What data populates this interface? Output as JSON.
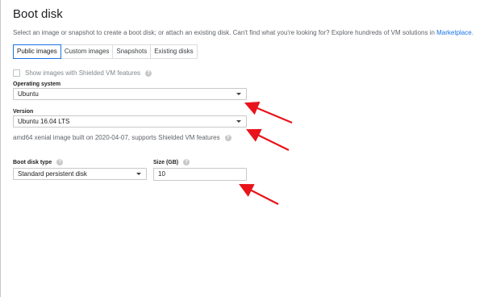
{
  "header": {
    "title": "Boot disk",
    "description": "Select an image or snapshot to create a boot disk; or attach an existing disk. Can't find what you're looking for? Explore hundreds of VM solutions in ",
    "marketplace_link": "Marketplace."
  },
  "tabs": [
    {
      "label": "Public images",
      "active": true
    },
    {
      "label": "Custom images",
      "active": false
    },
    {
      "label": "Snapshots",
      "active": false
    },
    {
      "label": "Existing disks",
      "active": false
    }
  ],
  "shielded_checkbox": {
    "label": "Show images with Shielded VM features",
    "checked": false
  },
  "operating_system": {
    "label": "Operating system",
    "value": "Ubuntu"
  },
  "version": {
    "label": "Version",
    "value": "Ubuntu 16.04 LTS",
    "info": "amd64 xenial image built on 2020-04-07, supports Shielded VM features"
  },
  "boot_disk_type": {
    "label": "Boot disk type",
    "value": "Standard persistent disk"
  },
  "size": {
    "label": "Size (GB)",
    "value": "10"
  },
  "colors": {
    "accent": "#1a73e8",
    "arrow": "#e8141a"
  }
}
